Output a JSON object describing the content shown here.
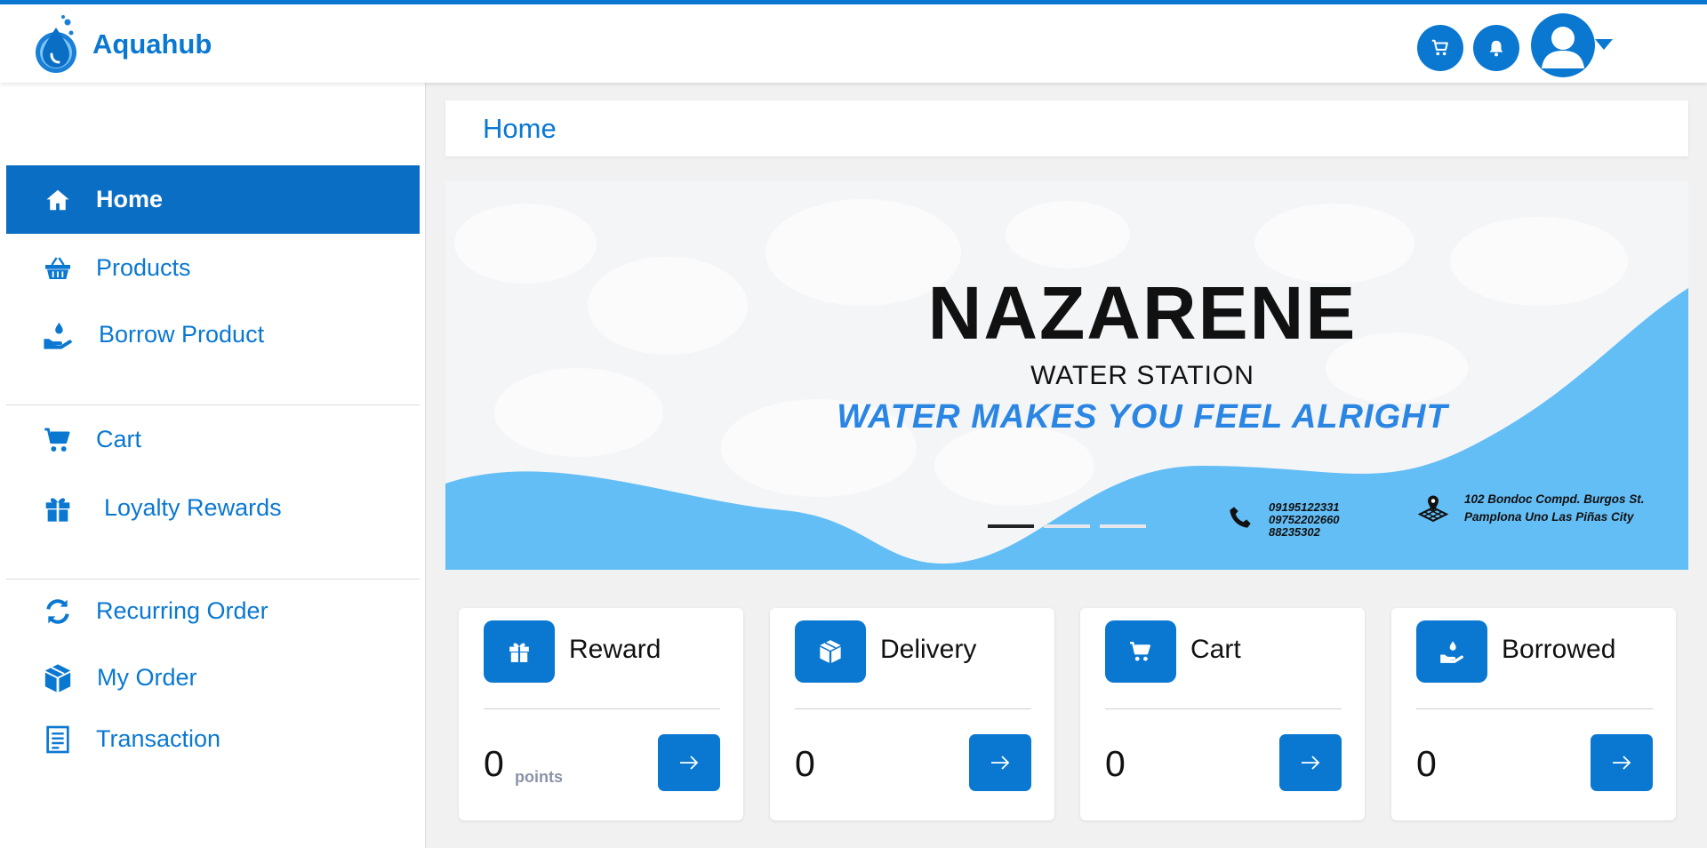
{
  "app": {
    "name": "Aquahub"
  },
  "header": {
    "icons": [
      "cart-icon",
      "bell-icon",
      "user-avatar-icon",
      "caret-down-icon"
    ]
  },
  "sidebar": {
    "items": [
      {
        "label": "Home",
        "icon": "home-icon",
        "active": true
      },
      {
        "label": "Products",
        "icon": "basket-icon"
      },
      {
        "label": "Borrow Product",
        "icon": "hand-water-drop-icon"
      },
      {
        "label": "Cart",
        "icon": "cart-icon"
      },
      {
        "label": "Loyalty Rewards",
        "icon": "gift-icon"
      },
      {
        "label": "Recurring Order",
        "icon": "recurring-icon"
      },
      {
        "label": "My Order",
        "icon": "box-icon"
      },
      {
        "label": "Transaction",
        "icon": "receipt-icon"
      }
    ]
  },
  "main": {
    "title": "Home"
  },
  "banner": {
    "title": "NAZARENE",
    "subtitle": "WATER STATION",
    "tagline": "WATER MAKES YOU FEEL ALRIGHT",
    "phones": [
      "09195122331",
      "09752202660",
      "88235302"
    ],
    "address": "102 Bondoc Compd. Burgos St. Pamplona Uno Las Piñas City",
    "slides": 3,
    "active_slide": 1
  },
  "cards": [
    {
      "title": "Reward",
      "value": "0",
      "unit": "points",
      "icon": "gift-icon"
    },
    {
      "title": "Delivery",
      "value": "0",
      "icon": "box-icon"
    },
    {
      "title": "Cart",
      "value": "0",
      "icon": "cart-icon"
    },
    {
      "title": "Borrowed",
      "value": "0",
      "icon": "hand-water-drop-icon"
    }
  ],
  "colors": {
    "accent": "#0a78d1",
    "wave": "#64bef6",
    "sidebar_active": "#0a6fc4"
  }
}
